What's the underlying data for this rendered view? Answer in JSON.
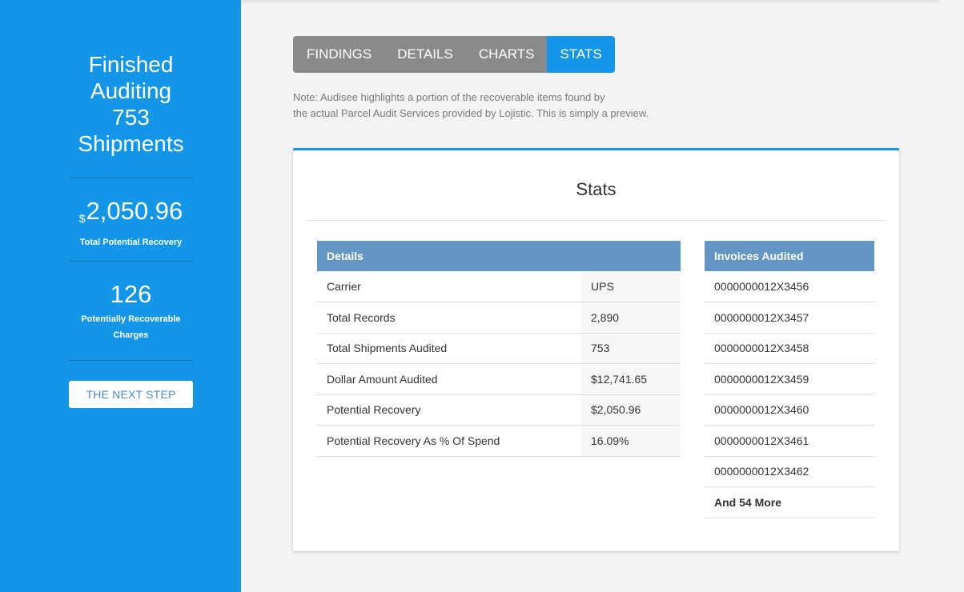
{
  "sidebar": {
    "title_lines": [
      "Finished",
      "Auditing",
      "753",
      "Shipments"
    ],
    "recovery": {
      "currency": "$",
      "amount": "2,050.96",
      "label": "Total Potential Recovery"
    },
    "charges": {
      "count": "126",
      "label_line1": "Potentially Recoverable",
      "label_line2": "Charges"
    },
    "next_step_label": "The Next Step"
  },
  "tabs": [
    {
      "label": "Findings",
      "active": false
    },
    {
      "label": "Details",
      "active": false
    },
    {
      "label": "Charts",
      "active": false
    },
    {
      "label": "Stats",
      "active": true
    }
  ],
  "note": {
    "line1": "Note: Audisee highlights a portion of the recoverable items found by",
    "line2": "the actual Parcel Audit Services provided by Lojistic. This is simply a preview."
  },
  "card": {
    "title": "Stats",
    "details": {
      "header": "Details",
      "rows": [
        {
          "label": "Carrier",
          "value": "UPS"
        },
        {
          "label": "Total Records",
          "value": "2,890"
        },
        {
          "label": "Total Shipments Audited",
          "value": "753"
        },
        {
          "label": "Dollar Amount Audited",
          "value": "$12,741.65"
        },
        {
          "label": "Potential Recovery",
          "value": "$2,050.96"
        },
        {
          "label": "Potential Recovery As % Of Spend",
          "value": "16.09%"
        }
      ]
    },
    "invoices": {
      "header": "Invoices Audited",
      "items": [
        "0000000012X3456",
        "0000000012X3457",
        "0000000012X3458",
        "0000000012X3459",
        "0000000012X3460",
        "0000000012X3461",
        "0000000012X3462"
      ],
      "more": "And 54 More"
    }
  },
  "colors": {
    "accent": "#1396e8",
    "table_header": "#6396c3",
    "tab_inactive": "#8a8a8a",
    "background": "#f3f3f3"
  }
}
